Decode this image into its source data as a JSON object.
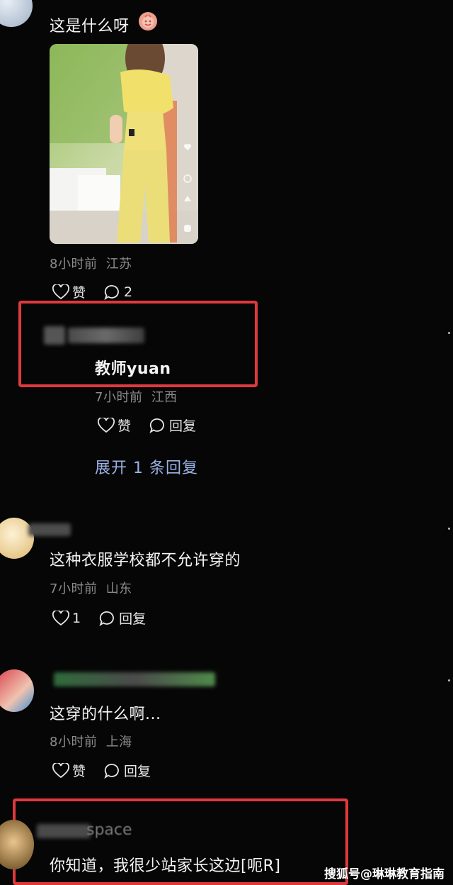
{
  "comments": [
    {
      "text": "这是什么呀",
      "time": "8小时前",
      "location": "江苏",
      "like_label": "赞",
      "reply_count": "2"
    },
    {
      "username": "教师yuan",
      "time": "7小时前",
      "location": "江西",
      "like_label": "赞",
      "reply_label": "回复",
      "expand_label": "展开 1 条回复"
    },
    {
      "text": "这种衣服学校都不允许穿的",
      "time": "7小时前",
      "location": "山东",
      "like_count": "1",
      "reply_label": "回复"
    },
    {
      "text": "这穿的什么啊...",
      "time": "8小时前",
      "location": "上海",
      "like_label": "赞",
      "reply_label": "回复"
    },
    {
      "username_partial": "space",
      "text": "你知道，我很少站家长这边[呃R]"
    }
  ],
  "watermark": "搜狐号@琳琳教育指南",
  "colors": {
    "highlight": "#e0393c",
    "link": "#9bb2e4",
    "meta": "#8b8b8b"
  }
}
